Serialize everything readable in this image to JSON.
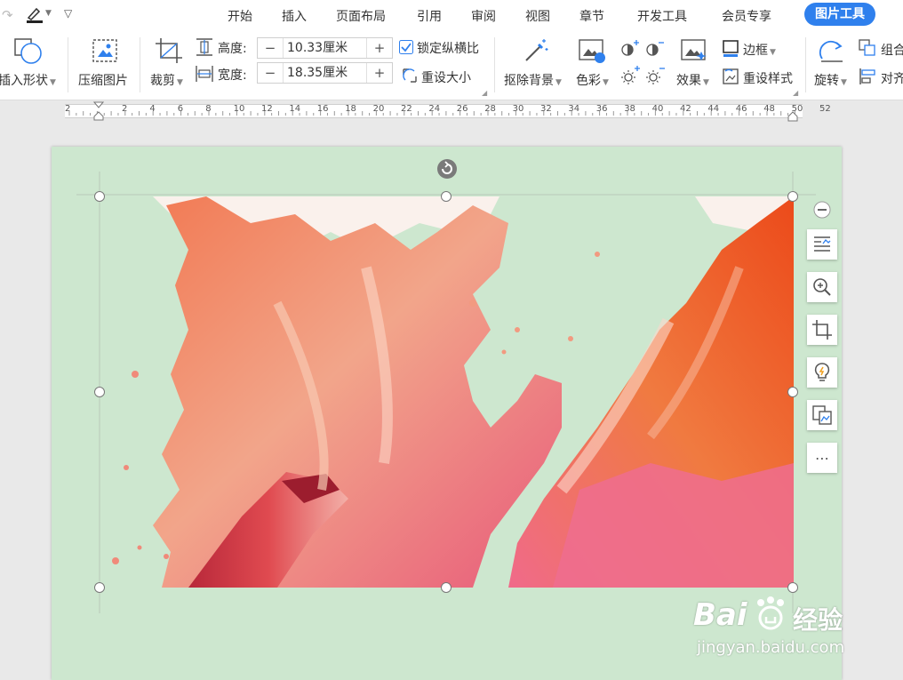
{
  "quick_access": {
    "pen_icon": "pen-icon",
    "more_icon": "chevron-down-icon"
  },
  "menu": {
    "tabs": [
      {
        "label": "开始"
      },
      {
        "label": "插入"
      },
      {
        "label": "页面布局"
      },
      {
        "label": "引用"
      },
      {
        "label": "审阅"
      },
      {
        "label": "视图"
      },
      {
        "label": "章节"
      },
      {
        "label": "开发工具"
      },
      {
        "label": "会员专享"
      }
    ],
    "active_tab": "图片工具",
    "accent_color": "#2f80ed"
  },
  "ribbon": {
    "insert_shape": "插入形状",
    "compress": "压缩图片",
    "crop": "裁剪",
    "height_label": "高度:",
    "height_value": "10.33厘米",
    "width_label": "宽度:",
    "width_value": "18.35厘米",
    "lock_ratio": "锁定纵横比",
    "lock_ratio_checked": true,
    "reset_size": "重设大小",
    "remove_bg": "抠除背景",
    "color": "色彩",
    "effects": "效果",
    "border": "边框",
    "reset_style": "重设样式",
    "rotate": "旋转",
    "group": "组合",
    "align": "对齐",
    "minus": "−",
    "plus": "+"
  },
  "ruler": {
    "numbers": [
      "2",
      "2",
      "4",
      "6",
      "8",
      "10",
      "12",
      "14",
      "16",
      "18",
      "20",
      "22",
      "24",
      "26",
      "28",
      "30",
      "32",
      "34",
      "36",
      "38",
      "40",
      "42",
      "44",
      "46",
      "48",
      "50",
      "52"
    ]
  },
  "document": {
    "page_color": "#cde7cf",
    "image_description": "red and pink abstract paint splash",
    "sidebar_tools": [
      "zoom-out-icon",
      "text-wrap-icon",
      "zoom-in-icon",
      "crop-icon",
      "lightbulb-icon",
      "image-convert-icon",
      "more-icon"
    ],
    "more_label": "⋯"
  },
  "watermark": {
    "brand": "Bai",
    "brand2": "经验",
    "url": "jingyan.baidu.com"
  }
}
